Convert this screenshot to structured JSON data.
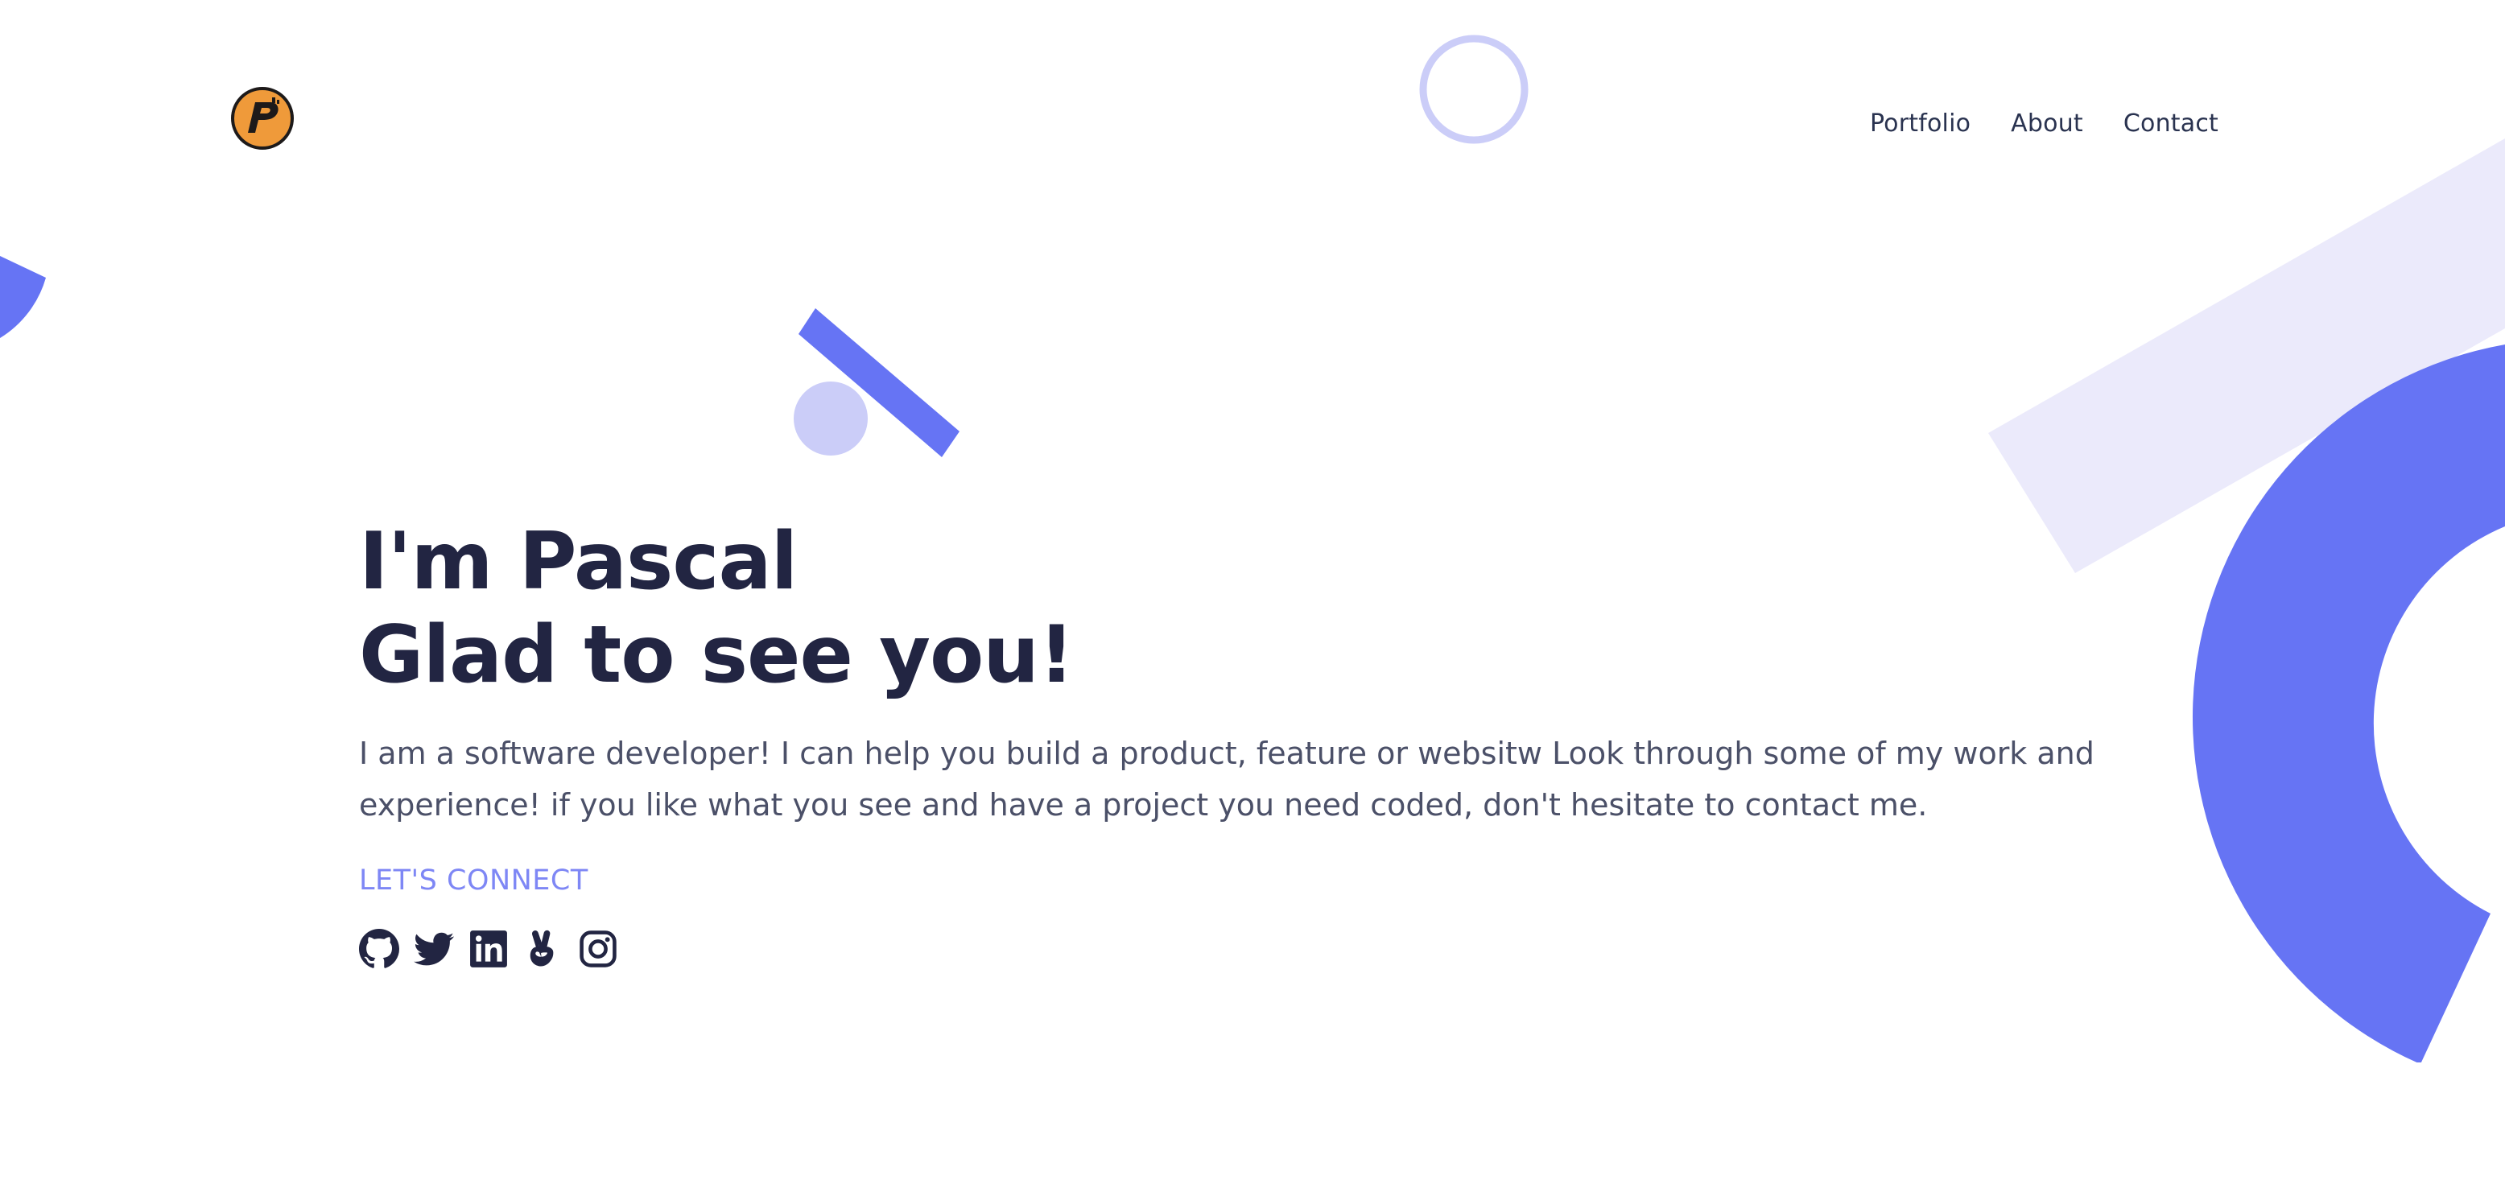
{
  "colors": {
    "accent": "#6674f4",
    "accent_light": "#cbcdf8",
    "accent_pale": "#ebeafb",
    "heading": "#222542",
    "body_text": "#4b5068",
    "link": "#7e87f5",
    "logo": "#ef9a3a"
  },
  "header": {
    "logo_icon": "logo-p-icon",
    "nav": [
      {
        "label": "Portfolio"
      },
      {
        "label": "About"
      },
      {
        "label": "Contact"
      }
    ]
  },
  "hero": {
    "title_line1": "I'm Pascal",
    "title_line2": "Glad to see you!",
    "intro": "I am a software developer! I can help you build a product, feature or websitw Look through some of my work and experience! if you like what you see and have a project you need coded, don't hesitate to contact me.",
    "connect_label": "LET'S CONNECT",
    "socials": [
      {
        "icon": "github-icon"
      },
      {
        "icon": "twitter-icon"
      },
      {
        "icon": "linkedin-icon"
      },
      {
        "icon": "angellist-icon"
      },
      {
        "icon": "instagram-icon"
      }
    ]
  }
}
